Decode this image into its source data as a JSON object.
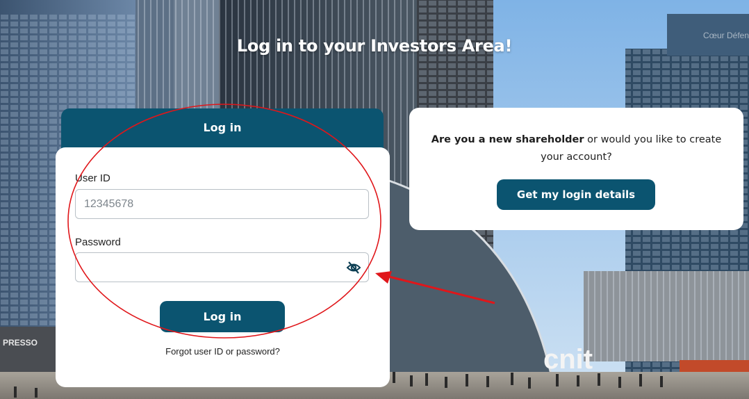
{
  "headline": "Log in to your Investors Area!",
  "login": {
    "tab_label": "Log in",
    "user_id_label": "User ID",
    "user_id_placeholder": "12345678",
    "password_label": "Password",
    "password_value": "",
    "submit_label": "Log in",
    "forgot_label": "Forgot user ID or password?",
    "eye_icon": "eye-slash-icon"
  },
  "new_shareholder": {
    "text_bold": "Are you a new shareholder",
    "text_rest": " or would you like to create your account?",
    "button_label": "Get my login details"
  },
  "background_signs": {
    "left_sign": "PRESSO",
    "right_sign": "cnit",
    "top_right_sign": "Cœur Défense"
  },
  "colors": {
    "primary": "#0b5470",
    "annotation": "#e0161a",
    "card": "#ffffff"
  }
}
